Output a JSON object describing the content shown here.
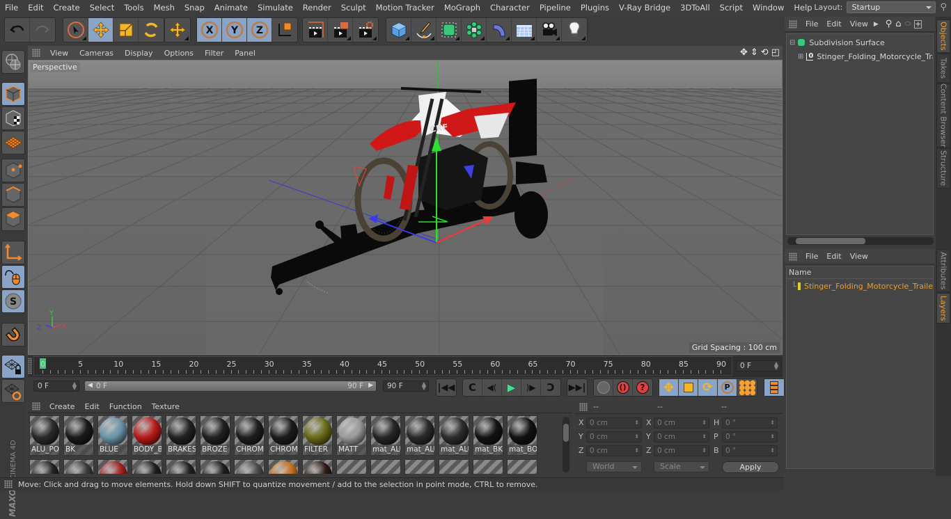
{
  "app": {
    "name": "Cinema 4D",
    "brand_top": "MAXON",
    "brand_bottom": "CINEMA 4D"
  },
  "menubar": {
    "items": [
      "File",
      "Edit",
      "Create",
      "Select",
      "Tools",
      "Mesh",
      "Snap",
      "Animate",
      "Simulate",
      "Render",
      "Sculpt",
      "Motion Tracker",
      "MoGraph",
      "Character",
      "Pipeline",
      "Plugins",
      "V-Ray Bridge",
      "3DToAll",
      "Script",
      "Window",
      "Help"
    ],
    "layout_label": "Layout:",
    "layout_value": "Startup"
  },
  "toolbar": {
    "groups": [
      {
        "name": "history",
        "buttons": [
          {
            "icon": "undo-icon",
            "active": false
          },
          {
            "icon": "redo-icon",
            "active": false,
            "disabled": true
          }
        ]
      },
      {
        "name": "transform",
        "buttons": [
          {
            "icon": "live-selection-icon",
            "active": false
          },
          {
            "icon": "move-icon",
            "active": true
          },
          {
            "icon": "scale-icon",
            "active": false
          },
          {
            "icon": "rotate-icon",
            "active": false
          }
        ]
      },
      {
        "name": "recent",
        "buttons": [
          {
            "icon": "move-tool-icon",
            "active": false
          }
        ]
      },
      {
        "name": "axes",
        "buttons": [
          {
            "icon": "x-axis-lock-icon",
            "label": "X",
            "active": true
          },
          {
            "icon": "y-axis-lock-icon",
            "label": "Y",
            "active": true
          },
          {
            "icon": "z-axis-lock-icon",
            "label": "Z",
            "active": true
          },
          {
            "icon": "coordinate-system-icon",
            "active": false
          }
        ]
      },
      {
        "name": "render",
        "buttons": [
          {
            "icon": "render-view-icon"
          },
          {
            "icon": "render-to-picture-viewer-icon"
          },
          {
            "icon": "render-settings-icon"
          }
        ]
      },
      {
        "name": "create",
        "buttons": [
          {
            "icon": "cube-icon"
          },
          {
            "icon": "pen-spline-icon"
          },
          {
            "icon": "subdivision-surface-icon"
          },
          {
            "icon": "cloner-icon"
          },
          {
            "icon": "deformer-bend-icon"
          },
          {
            "icon": "floor-icon"
          },
          {
            "icon": "camera-icon"
          },
          {
            "icon": "light-icon"
          }
        ]
      }
    ]
  },
  "left_tools": [
    {
      "icon": "make-editable-icon",
      "active": false
    },
    {
      "icon": "model-mode-icon",
      "active": true
    },
    {
      "icon": "texture-mode-icon",
      "active": false
    },
    {
      "icon": "workplane-mode-icon",
      "active": false
    },
    {
      "icon": "points-mode-icon",
      "active": false
    },
    {
      "icon": "edges-mode-icon",
      "active": false
    },
    {
      "icon": "polygons-mode-icon",
      "active": false
    },
    {
      "icon": "axis-mode-icon",
      "active": false
    },
    {
      "icon": "tweak-mode-icon",
      "active": true
    },
    {
      "icon": "solo-icon",
      "active": true
    },
    {
      "icon": "snap-magnet-icon",
      "active": false
    },
    {
      "icon": "workplane-lock-icon",
      "active": true
    },
    {
      "icon": "workplane-align-icon",
      "active": false
    }
  ],
  "viewport": {
    "menu": [
      "View",
      "Cameras",
      "Display",
      "Options",
      "Filter",
      "Panel"
    ],
    "camera_label": "Perspective",
    "grid_spacing": "Grid Spacing : 100 cm",
    "nav_icons": [
      "pan-icon",
      "dolly-icon",
      "orbit-icon",
      "maximize-view-icon"
    ],
    "axis_labels": {
      "x": "X",
      "y": "Y",
      "z": "Z"
    }
  },
  "timeline": {
    "ticks": [
      0,
      5,
      10,
      15,
      20,
      25,
      30,
      35,
      40,
      45,
      50,
      55,
      60,
      65,
      70,
      75,
      80,
      85,
      90
    ],
    "current_frame": "0 F",
    "playhead": 0,
    "max": 90
  },
  "transport": {
    "start_field": "0 F",
    "range_start": "0 F",
    "range_end": "90 F",
    "end_field": "90 F",
    "buttons": [
      "go-to-start-icon",
      "previous-key-icon",
      "previous-frame-icon",
      "play-icon",
      "next-frame-icon",
      "next-key-icon",
      "go-to-end-icon"
    ],
    "key_buttons": [
      "record-disabled-icon",
      "autokey-icon",
      "keyframe-selection-icon"
    ],
    "track_buttons": [
      "move-key-icon",
      "scale-key-icon",
      "rotation-key-icon",
      "parameter-key-icon",
      "point-level-icon"
    ],
    "timeline_button": "timeline-window-icon"
  },
  "material_manager": {
    "menu": [
      "Create",
      "Edit",
      "Function",
      "Texture"
    ],
    "materials_row1": [
      {
        "name": "ALU_PO",
        "color": "#2a2a2a"
      },
      {
        "name": "BK",
        "color": "#1a1a1a"
      },
      {
        "name": "BLUE",
        "color": "#6a94a8"
      },
      {
        "name": "BODY_BI",
        "color": "#b81a1a"
      },
      {
        "name": "BRAKES",
        "color": "#222222"
      },
      {
        "name": "BROZE",
        "color": "#202020"
      },
      {
        "name": "CHROM",
        "color": "#1e1e1e"
      },
      {
        "name": "CHROM",
        "color": "#1c1c1c"
      },
      {
        "name": "FILTER",
        "color": "#6a6a18"
      },
      {
        "name": "MATT",
        "color": "#9a9a9a"
      },
      {
        "name": "mat_ALU",
        "color": "#262626"
      },
      {
        "name": "mat_ALU",
        "color": "#2a2a2a"
      },
      {
        "name": "mat_ALU",
        "color": "#2c2c2c"
      },
      {
        "name": "mat_BK_",
        "color": "#141414"
      },
      {
        "name": "mat_BOI",
        "color": "#121212"
      }
    ],
    "materials_row2": [
      {
        "color": "#222222"
      },
      {
        "color": "#3a3a3a"
      },
      {
        "color": "#a02020"
      },
      {
        "color": "#1e1e1e"
      },
      {
        "color": "#202020"
      },
      {
        "color": "#1e1e1e"
      },
      {
        "color": "#4a4a4a"
      },
      {
        "color": "#c8701e"
      },
      {
        "color": "#2a1a14"
      }
    ]
  },
  "coordinates": {
    "headers": [
      "--",
      "--",
      "--"
    ],
    "position": [
      {
        "axis": "X",
        "value": "0 cm"
      },
      {
        "axis": "Y",
        "value": "0 cm"
      },
      {
        "axis": "Z",
        "value": "0 cm"
      }
    ],
    "size": [
      {
        "axis": "X",
        "value": "0 cm"
      },
      {
        "axis": "Y",
        "value": "0 cm"
      },
      {
        "axis": "Z",
        "value": "0 cm"
      }
    ],
    "rotation": [
      {
        "axis": "H",
        "value": "0 °"
      },
      {
        "axis": "P",
        "value": "0 °"
      },
      {
        "axis": "B",
        "value": "0 °"
      }
    ],
    "space_dropdown": "World",
    "mode_dropdown": "Scale",
    "apply_label": "Apply"
  },
  "object_manager": {
    "menu": [
      "File",
      "Edit",
      "View"
    ],
    "objects": [
      {
        "name": "Subdivision Surface",
        "icon": "subdivision-surface-icon",
        "level": 0
      },
      {
        "name": "Stinger_Folding_Motorcycle_Trai",
        "icon": "null-object-icon",
        "level": 1
      }
    ]
  },
  "layer_manager": {
    "menu": [
      "File",
      "Edit",
      "View"
    ],
    "column": "Name",
    "layers": [
      {
        "name": "Stinger_Folding_Motorcycle_Traile",
        "color": "#e0d020"
      }
    ]
  },
  "side_tabs_top": [
    {
      "label": "Objects",
      "active": true
    },
    {
      "label": "Takes",
      "active": false
    },
    {
      "label": "Content Browser",
      "active": false
    },
    {
      "label": "Structure",
      "active": false
    }
  ],
  "side_tabs_bottom": [
    {
      "label": "Attributes",
      "active": false
    },
    {
      "label": "Layers",
      "active": true
    }
  ],
  "status": "Move: Click and drag to move elements. Hold down SHIFT to quantize movement / add to the selection in point mode, CTRL to remove."
}
